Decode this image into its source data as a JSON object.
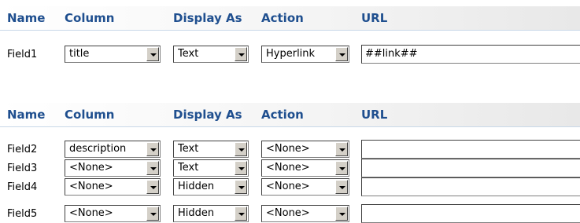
{
  "headers": {
    "name": "Name",
    "column": "Column",
    "display_as": "Display As",
    "action": "Action",
    "url": "URL"
  },
  "top_row": {
    "name": "Field1",
    "column": "title",
    "display_as": "Text",
    "action": "Hyperlink",
    "url": "##link##"
  },
  "rows": [
    {
      "name": "Field2",
      "column": "description",
      "display_as": "Text",
      "action": "<None>",
      "url": ""
    },
    {
      "name": "Field3",
      "column": "<None>",
      "display_as": "Text",
      "action": "<None>",
      "url": ""
    },
    {
      "name": "Field4",
      "column": "<None>",
      "display_as": "Hidden",
      "action": "<None>",
      "url": ""
    },
    {
      "name": "Field5",
      "column": "<None>",
      "display_as": "Hidden",
      "action": "<None>",
      "url": ""
    }
  ],
  "colors": {
    "header_text": "#1f4f8f",
    "header_rule": "#c8d8e8"
  }
}
